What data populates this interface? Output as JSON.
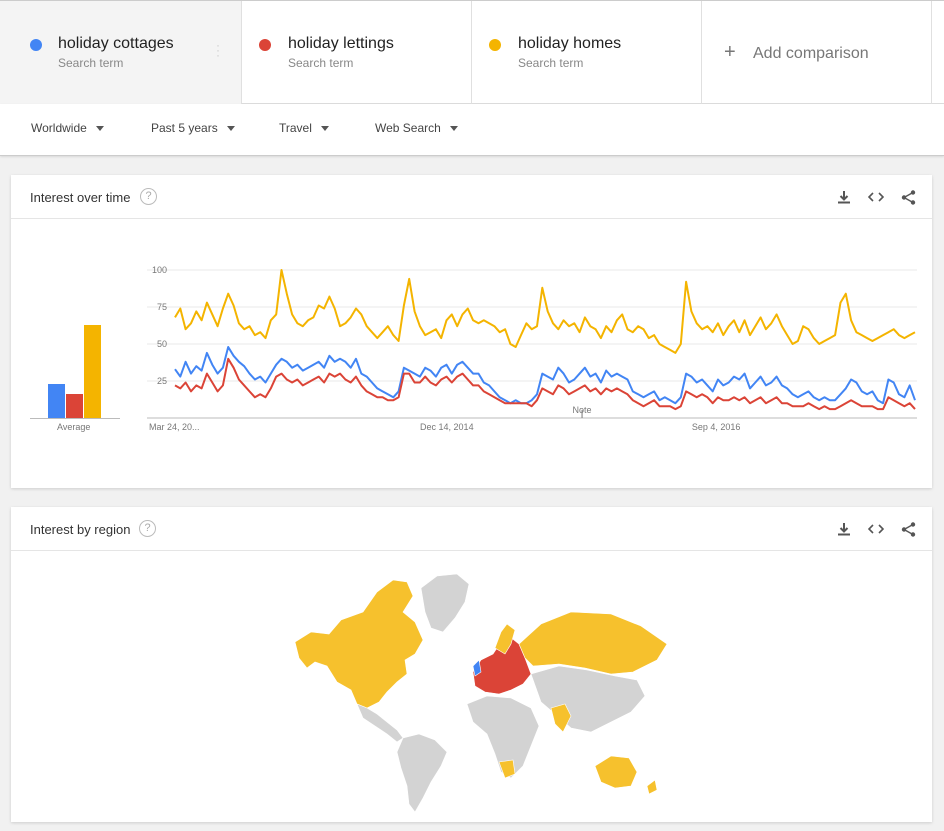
{
  "terms": [
    {
      "name": "holiday cottages",
      "sub": "Search term",
      "color": "#4285f4"
    },
    {
      "name": "holiday lettings",
      "sub": "Search term",
      "color": "#db4437"
    },
    {
      "name": "holiday homes",
      "sub": "Search term",
      "color": "#f4b400"
    }
  ],
  "add_comparison": {
    "icon": "plus-icon",
    "label": "Add comparison"
  },
  "filters": {
    "region": "Worldwide",
    "time": "Past 5 years",
    "category": "Travel",
    "search_type": "Web Search"
  },
  "interest_over_time": {
    "title": "Interest over time",
    "help": "?",
    "average_label": "Average",
    "note_label": "Note",
    "tools": [
      "download-icon",
      "embed-icon",
      "share-icon"
    ]
  },
  "interest_by_region": {
    "title": "Interest by region",
    "help": "?",
    "tools": [
      "download-icon",
      "embed-icon",
      "share-icon"
    ]
  },
  "chart_data": {
    "type": "line",
    "ylim": [
      0,
      100
    ],
    "yticks": [
      "100",
      "75",
      "50",
      "25"
    ],
    "xticks": [
      "Mar 24, 20...",
      "Dec 14, 2014",
      "Sep 4, 2016"
    ],
    "averages": [
      {
        "name": "holiday cottages",
        "value": 23,
        "color": "#4285f4"
      },
      {
        "name": "holiday lettings",
        "value": 16,
        "color": "#db4437"
      },
      {
        "name": "holiday homes",
        "value": 63,
        "color": "#f4b400"
      }
    ],
    "series": [
      {
        "name": "holiday cottages",
        "color": "#4285f4",
        "values": [
          33,
          28,
          38,
          30,
          35,
          32,
          44,
          36,
          30,
          34,
          48,
          42,
          38,
          35,
          30,
          26,
          28,
          24,
          30,
          36,
          40,
          38,
          34,
          36,
          32,
          34,
          36,
          38,
          34,
          42,
          38,
          40,
          38,
          34,
          40,
          30,
          28,
          24,
          20,
          18,
          16,
          14,
          18,
          34,
          32,
          30,
          28,
          34,
          32,
          28,
          34,
          36,
          30,
          36,
          38,
          34,
          30,
          30,
          24,
          22,
          18,
          14,
          12,
          10,
          12,
          10,
          10,
          12,
          16,
          30,
          28,
          26,
          34,
          30,
          24,
          26,
          30,
          34,
          28,
          30,
          24,
          32,
          28,
          30,
          28,
          26,
          18,
          16,
          14,
          16,
          18,
          12,
          14,
          12,
          10,
          14,
          30,
          28,
          24,
          26,
          22,
          18,
          26,
          22,
          24,
          28,
          26,
          30,
          20,
          24,
          28,
          22,
          24,
          28,
          22,
          20,
          16,
          14,
          16,
          18,
          14,
          12,
          14,
          12,
          12,
          16,
          20,
          26,
          24,
          18,
          16,
          18,
          12,
          10,
          26,
          24,
          16,
          14,
          22,
          12
        ]
      },
      {
        "name": "holiday lettings",
        "color": "#db4437",
        "values": [
          22,
          20,
          24,
          18,
          22,
          20,
          30,
          24,
          18,
          22,
          40,
          34,
          26,
          22,
          18,
          14,
          16,
          14,
          20,
          28,
          30,
          26,
          24,
          26,
          22,
          24,
          26,
          28,
          24,
          30,
          28,
          30,
          26,
          24,
          28,
          22,
          18,
          16,
          14,
          14,
          12,
          12,
          14,
          30,
          30,
          24,
          24,
          28,
          24,
          22,
          26,
          28,
          24,
          28,
          30,
          26,
          22,
          22,
          18,
          16,
          14,
          12,
          10,
          10,
          10,
          10,
          10,
          8,
          12,
          20,
          18,
          16,
          22,
          20,
          16,
          18,
          20,
          22,
          18,
          20,
          16,
          20,
          18,
          20,
          18,
          16,
          12,
          10,
          8,
          10,
          12,
          8,
          8,
          8,
          6,
          8,
          18,
          16,
          14,
          16,
          14,
          10,
          14,
          12,
          12,
          14,
          12,
          14,
          10,
          12,
          14,
          10,
          12,
          14,
          10,
          10,
          8,
          8,
          8,
          10,
          8,
          6,
          8,
          6,
          6,
          8,
          10,
          12,
          10,
          8,
          8,
          8,
          6,
          6,
          14,
          12,
          10,
          8,
          10,
          6
        ]
      },
      {
        "name": "holiday homes",
        "color": "#f4b400",
        "values": [
          68,
          74,
          60,
          64,
          72,
          66,
          78,
          70,
          62,
          74,
          84,
          76,
          64,
          60,
          62,
          56,
          58,
          54,
          66,
          70,
          100,
          84,
          70,
          64,
          62,
          66,
          68,
          76,
          74,
          82,
          74,
          62,
          64,
          68,
          74,
          70,
          62,
          58,
          54,
          58,
          62,
          56,
          52,
          76,
          94,
          72,
          62,
          56,
          58,
          60,
          54,
          66,
          70,
          62,
          70,
          74,
          66,
          64,
          66,
          64,
          62,
          58,
          60,
          50,
          48,
          56,
          64,
          60,
          62,
          88,
          72,
          64,
          60,
          66,
          62,
          64,
          58,
          68,
          62,
          60,
          54,
          62,
          58,
          66,
          70,
          60,
          58,
          62,
          60,
          54,
          56,
          50,
          48,
          46,
          44,
          50,
          92,
          72,
          64,
          60,
          62,
          58,
          64,
          56,
          62,
          66,
          58,
          66,
          56,
          62,
          68,
          60,
          64,
          70,
          62,
          56,
          50,
          52,
          62,
          60,
          54,
          50,
          52,
          54,
          56,
          78,
          84,
          66,
          58,
          56,
          54,
          52,
          54,
          56,
          58,
          60,
          56,
          54,
          56,
          58
        ]
      }
    ]
  }
}
